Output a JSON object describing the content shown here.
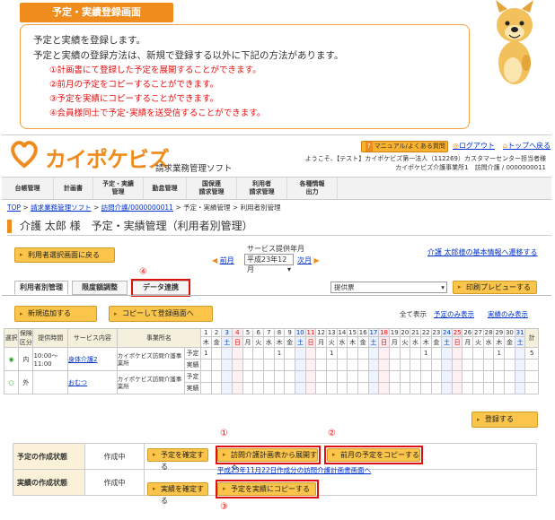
{
  "intro": {
    "title": "予定・実績登録画面",
    "lines": [
      "予定と実績を登録します。",
      "予定と実績の登録方法は、新規で登録する以外に下記の方法があります。"
    ],
    "methods": [
      "①計画書にて登録した予定を展開することができます。",
      "②前月の予定をコピーすることができます。",
      "③予定を実績にコピーすることができます。",
      "④会員様同士で予定･実績を送受信することができます。"
    ]
  },
  "header": {
    "logo_text": "カイポケビズ",
    "logo_sub": "請求業務管理ソフト",
    "manual_button": "マニュアル/よくある質問",
    "logout": "ログアウト",
    "top_link": "トップへ戻る",
    "welcome": "ようこそ、【テスト】カイポケビズ第一法人（112269）カスタマーセンター担当者様",
    "office": "カイポケビズ介護事業所1　訪問介護 / 0000000011"
  },
  "nav": [
    "台帳管理",
    "計画書",
    "予定・実績\n管理",
    "勤怠管理",
    "国保連\n請求管理",
    "利用者\n請求管理",
    "各種情報\n出力"
  ],
  "breadcrumb": {
    "top": "TOP",
    "software": "請求業務管理ソフト",
    "office": "訪問介護/0000000011",
    "sched": "予定・実績管理",
    "user": "利用者別管理",
    "sep": ">"
  },
  "page": {
    "title": "介護 太郎 様　予定・実績管理（利用者別管理）",
    "back_button": "利用者選択画面に戻る",
    "month_label": "サービス提供年月",
    "prev": "前月",
    "next": "次月",
    "month_value": "平成23年12月",
    "basic_info_link": "介護 太郎様の基本情報へ遷移する",
    "tabs": [
      "利用者別管理",
      "限度額調整",
      "データ連携"
    ],
    "print_select": "提供票",
    "print_button": "印刷プレビューする",
    "add_button": "新規追加する",
    "copy_button": "コピーして登録画面へ",
    "show_all": "全て表示",
    "show_plan": "予定のみ表示",
    "show_actual": "実績のみ表示",
    "register_button": "登録する",
    "circled_4": "④"
  },
  "grid": {
    "headers": [
      "選択",
      "保険\n区分",
      "提供時間",
      "サービス内容",
      "事業所名"
    ],
    "days": [
      "1",
      "2",
      "3",
      "4",
      "5",
      "6",
      "7",
      "8",
      "9",
      "10",
      "11",
      "12",
      "13",
      "14",
      "15",
      "16",
      "17",
      "18",
      "19",
      "20",
      "21",
      "22",
      "23",
      "24",
      "25",
      "26",
      "27",
      "28",
      "29",
      "30",
      "31"
    ],
    "weekdays": [
      "木",
      "金",
      "土",
      "日",
      "月",
      "火",
      "水",
      "木",
      "金",
      "土",
      "日",
      "月",
      "火",
      "水",
      "木",
      "金",
      "土",
      "日",
      "月",
      "火",
      "水",
      "木",
      "金",
      "土",
      "日",
      "月",
      "火",
      "水",
      "木",
      "金",
      "土"
    ],
    "total_label": "計",
    "rows": [
      {
        "kubun": "内",
        "time": "10:00〜\n11:00",
        "service": "身体介護2",
        "office": "カイポケビズ訪問介護事業所",
        "plan_label": "予定",
        "actual_label": "実績",
        "plan_marks": {
          "1": "1",
          "8": "1",
          "13": "1",
          "22": "1",
          "29": "1"
        },
        "total": "5"
      },
      {
        "kubun": "外",
        "time": "",
        "service": "おむつ",
        "office": "カイポケビズ訪問介護事業所",
        "plan_label": "予定",
        "actual_label": "実績",
        "plan_marks": {},
        "total": ""
      }
    ]
  },
  "status": {
    "plan_label": "予定の作成状態",
    "plan_state": "作成中",
    "plan_confirm": "予定を確定する",
    "expand_button": "訪問介護計画表から展開する",
    "prev_copy_button": "前月の予定をコピーする",
    "expand_link": "平成23年11月22日作成分の訪問介護計画書画面へ",
    "actual_label": "実績の作成状態",
    "actual_state": "作成中",
    "actual_confirm": "実績を確定する",
    "plan_to_actual_button": "予定を実績にコピーする",
    "circled_1": "①",
    "circled_2": "②",
    "circled_3": "③"
  },
  "colors": {
    "accent": "#f08c1e",
    "button": "#fbc44a",
    "highlight": "#e01010",
    "link": "#0033cc"
  }
}
